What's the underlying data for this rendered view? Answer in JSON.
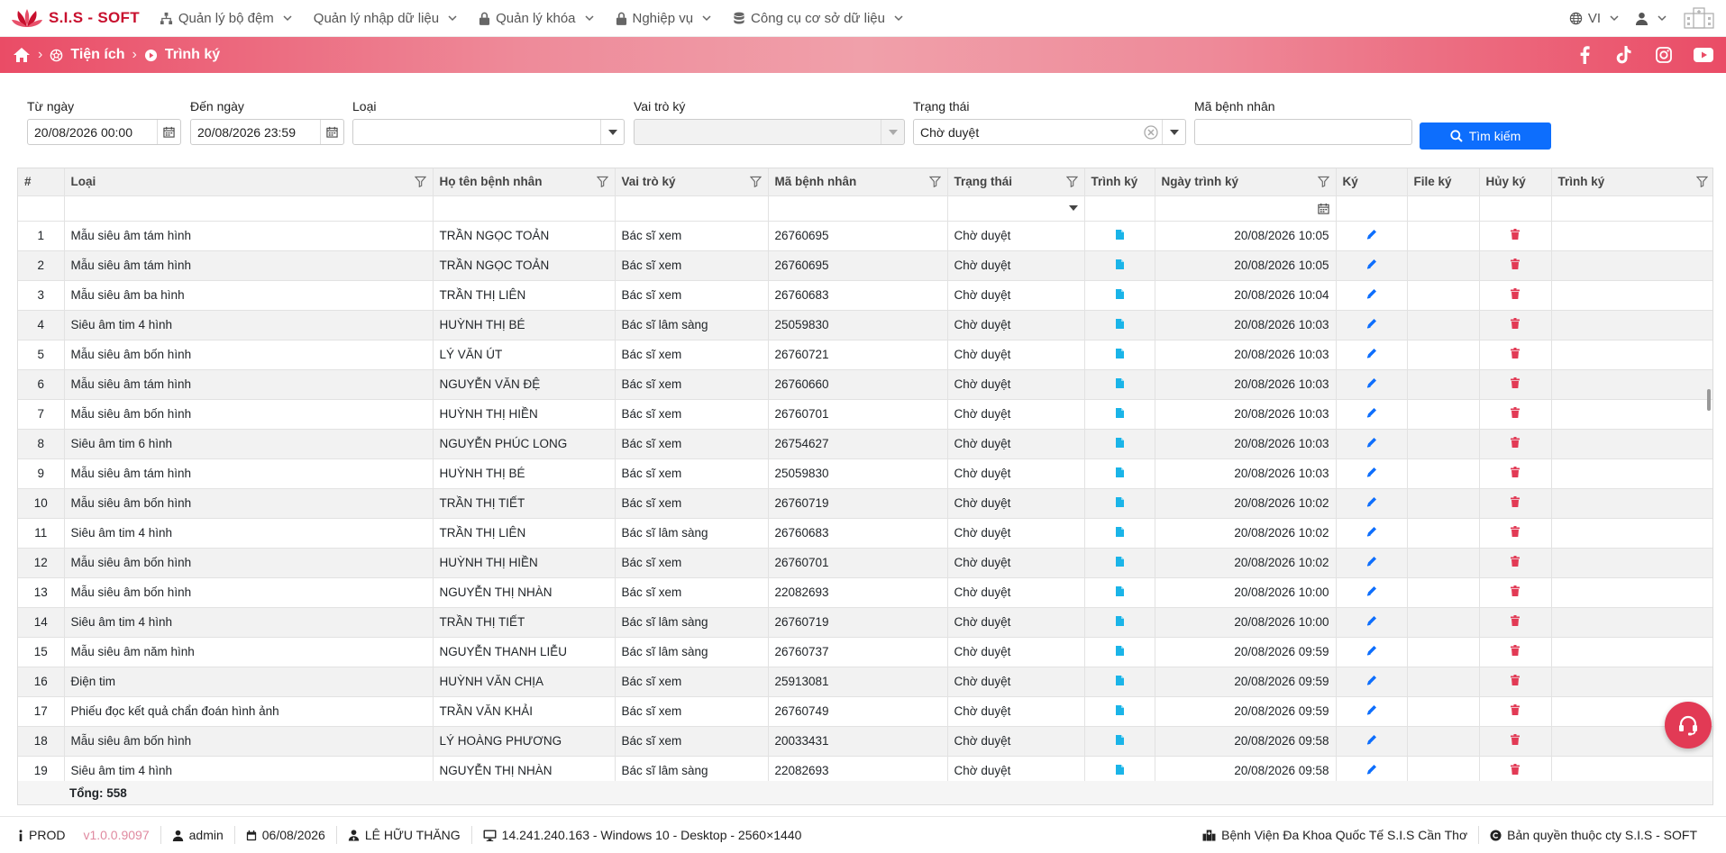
{
  "brand": {
    "name": "S.I.S - SOFT",
    "color": "#c8102e"
  },
  "menu": [
    {
      "label": "Quản lý bộ đệm",
      "icon": "hierarchy-icon"
    },
    {
      "label": "Quản lý nhập dữ liệu",
      "icon": ""
    },
    {
      "label": "Quản lý khóa",
      "icon": "lock-icon"
    },
    {
      "label": "Nghiệp vụ",
      "icon": "briefcase-icon"
    },
    {
      "label": "Công cụ cơ sở dữ liệu",
      "icon": "database-icon"
    }
  ],
  "topright": {
    "language": "VI"
  },
  "breadcrumb": {
    "level1": "Tiện ích",
    "level2": "Trình ký"
  },
  "filters": {
    "from_label": "Từ ngày",
    "from_value": "20/08/2026 00:00",
    "to_label": "Đến ngày",
    "to_value": "20/08/2026 23:59",
    "type_label": "Loại",
    "type_value": "",
    "role_label": "Vai trò ký",
    "role_value": "",
    "status_label": "Trạng thái",
    "status_value": "Chờ duyệt",
    "patient_label": "Mã bệnh nhân",
    "patient_value": "",
    "search_label": "Tìm kiếm"
  },
  "columns": [
    "#",
    "Loại",
    "Họ tên bệnh nhân",
    "Vai trò ký",
    "Mã bệnh nhân",
    "Trạng thái",
    "Trình ký",
    "Ngày trình ký",
    "Ký",
    "File ký",
    "Hủy ký",
    "Trình ký"
  ],
  "rows": [
    {
      "n": "1",
      "type": "Mẫu siêu âm tám hình",
      "name": "TRẦN NGỌC TOẢN",
      "role": "Bác sĩ xem",
      "pid": "26760695",
      "status": "Chờ duyệt",
      "date": "20/08/2026 10:05"
    },
    {
      "n": "2",
      "type": "Mẫu siêu âm tám hình",
      "name": "TRẦN NGỌC TOẢN",
      "role": "Bác sĩ xem",
      "pid": "26760695",
      "status": "Chờ duyệt",
      "date": "20/08/2026 10:05"
    },
    {
      "n": "3",
      "type": "Mẫu siêu âm ba hình",
      "name": "TRẦN THỊ LIÊN",
      "role": "Bác sĩ xem",
      "pid": "26760683",
      "status": "Chờ duyệt",
      "date": "20/08/2026 10:04"
    },
    {
      "n": "4",
      "type": "Siêu âm tim 4 hình",
      "name": "HUỲNH THỊ BÉ",
      "role": "Bác sĩ lâm sàng",
      "pid": "25059830",
      "status": "Chờ duyệt",
      "date": "20/08/2026 10:03"
    },
    {
      "n": "5",
      "type": "Mẫu siêu âm bốn hình",
      "name": "LÝ VĂN ÚT",
      "role": "Bác sĩ xem",
      "pid": "26760721",
      "status": "Chờ duyệt",
      "date": "20/08/2026 10:03"
    },
    {
      "n": "6",
      "type": "Mẫu siêu âm tám hình",
      "name": "NGUYỄN VĂN ĐỆ",
      "role": "Bác sĩ xem",
      "pid": "26760660",
      "status": "Chờ duyệt",
      "date": "20/08/2026 10:03"
    },
    {
      "n": "7",
      "type": "Mẫu siêu âm bốn hình",
      "name": "HUỲNH THỊ HIỀN",
      "role": "Bác sĩ xem",
      "pid": "26760701",
      "status": "Chờ duyệt",
      "date": "20/08/2026 10:03"
    },
    {
      "n": "8",
      "type": "Siêu âm tim 6 hình",
      "name": "NGUYỄN PHÚC LONG",
      "role": "Bác sĩ xem",
      "pid": "26754627",
      "status": "Chờ duyệt",
      "date": "20/08/2026 10:03"
    },
    {
      "n": "9",
      "type": "Mẫu siêu âm tám hình",
      "name": "HUỲNH THỊ BÉ",
      "role": "Bác sĩ xem",
      "pid": "25059830",
      "status": "Chờ duyệt",
      "date": "20/08/2026 10:03"
    },
    {
      "n": "10",
      "type": "Mẫu siêu âm bốn hình",
      "name": "TRẦN THỊ TIẾT",
      "role": "Bác sĩ xem",
      "pid": "26760719",
      "status": "Chờ duyệt",
      "date": "20/08/2026 10:02"
    },
    {
      "n": "11",
      "type": "Siêu âm tim 4 hình",
      "name": "TRẦN THỊ LIÊN",
      "role": "Bác sĩ lâm sàng",
      "pid": "26760683",
      "status": "Chờ duyệt",
      "date": "20/08/2026 10:02"
    },
    {
      "n": "12",
      "type": "Mẫu siêu âm bốn hình",
      "name": "HUỲNH THỊ HIỀN",
      "role": "Bác sĩ xem",
      "pid": "26760701",
      "status": "Chờ duyệt",
      "date": "20/08/2026 10:02"
    },
    {
      "n": "13",
      "type": "Mẫu siêu âm bốn hình",
      "name": "NGUYỄN THỊ NHÀN",
      "role": "Bác sĩ xem",
      "pid": "22082693",
      "status": "Chờ duyệt",
      "date": "20/08/2026 10:00"
    },
    {
      "n": "14",
      "type": "Siêu âm tim 4 hình",
      "name": "TRẦN THỊ TIẾT",
      "role": "Bác sĩ lâm sàng",
      "pid": "26760719",
      "status": "Chờ duyệt",
      "date": "20/08/2026 10:00"
    },
    {
      "n": "15",
      "type": "Mẫu siêu âm năm hình",
      "name": "NGUYỄN THANH LIỄU",
      "role": "Bác sĩ lâm sàng",
      "pid": "26760737",
      "status": "Chờ duyệt",
      "date": "20/08/2026 09:59"
    },
    {
      "n": "16",
      "type": "Điện tim",
      "name": "HUỲNH VĂN CHỊA",
      "role": "Bác sĩ xem",
      "pid": "25913081",
      "status": "Chờ duyệt",
      "date": "20/08/2026 09:59"
    },
    {
      "n": "17",
      "type": "Phiếu đọc kết quả chẩn đoán hình ảnh",
      "name": "TRẦN VĂN KHẢI",
      "role": "Bác sĩ xem",
      "pid": "26760749",
      "status": "Chờ duyệt",
      "date": "20/08/2026 09:59"
    },
    {
      "n": "18",
      "type": "Mẫu siêu âm bốn hình",
      "name": "LÝ HOÀNG PHƯƠNG",
      "role": "Bác sĩ xem",
      "pid": "20033431",
      "status": "Chờ duyệt",
      "date": "20/08/2026 09:58"
    },
    {
      "n": "19",
      "type": "Siêu âm tim 4 hình",
      "name": "NGUYỄN THỊ NHÀN",
      "role": "Bác sĩ lâm sàng",
      "pid": "22082693",
      "status": "Chờ duyệt",
      "date": "20/08/2026 09:58"
    }
  ],
  "total": "Tổng: 558",
  "footer": {
    "env": "PROD",
    "version": "v1.0.0.9097",
    "user": "admin",
    "date": "06/08/2026",
    "doctor": "LÊ HỮU THĂNG",
    "machine": "14.241.240.163 - Windows 10 - Desktop - 2560×1440",
    "hospital": "Bệnh Viện Đa Khoa Quốc Tế S.I.S Cần Thơ",
    "copyright": "Bản quyền thuộc cty S.I.S - SOFT"
  },
  "colors": {
    "accent": "#0d6efd",
    "band": "#ea4c66",
    "sign_icon": "#0d6efd",
    "file_icon": "#1ab4e8",
    "delete_icon": "#e23a55"
  }
}
